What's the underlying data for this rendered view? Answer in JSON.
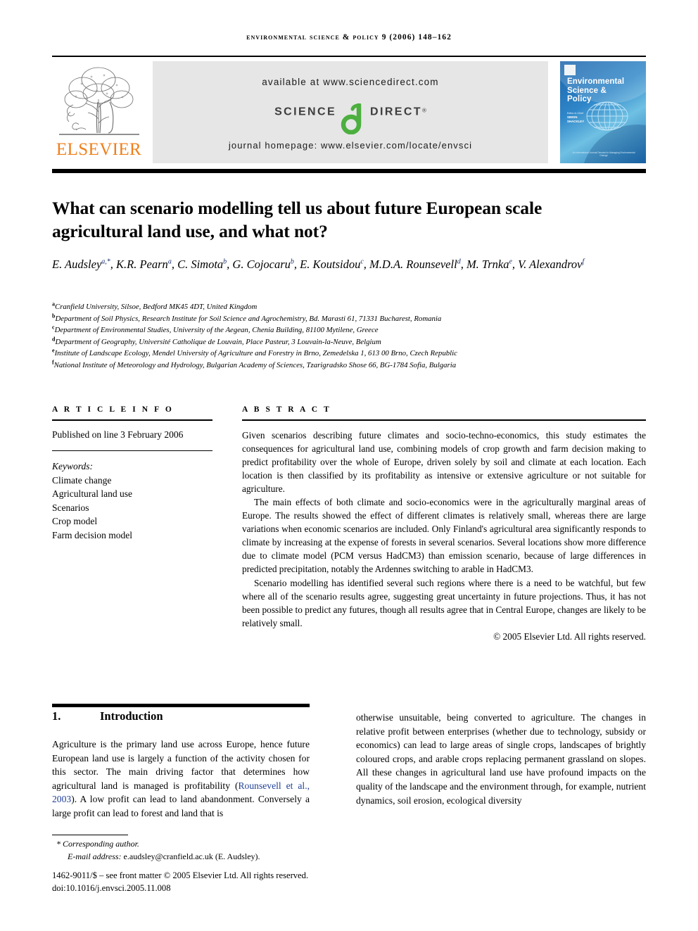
{
  "running_head": "environmental science & policy 9 (2006) 148–162",
  "masthead": {
    "publisher": "ELSEVIER",
    "publisher_logo_icon": "elsevier-tree-icon",
    "available_at": "available at www.sciencedirect.com",
    "sciencedirect_left": "SCIENCE",
    "sciencedirect_right": "DIRECT",
    "sciencedirect_reg": "®",
    "journal_homepage": "journal homepage: www.elsevier.com/locate/envsci",
    "cover": {
      "title": "Environmental Science & Policy",
      "editor_label": "Editor-in-Chief",
      "editor_name": "SIMON SHACKLEY",
      "footer": "An International Journal Devoted to Managing Environmental Change"
    }
  },
  "article": {
    "title": "What can scenario modelling tell us about future European scale agricultural land use, and what not?",
    "authors": [
      {
        "name": "E. Audsley",
        "marks": "a,*"
      },
      {
        "name": "K.R. Pearn",
        "marks": "a"
      },
      {
        "name": "C. Simota",
        "marks": "b"
      },
      {
        "name": "G. Cojocaru",
        "marks": "b"
      },
      {
        "name": "E. Koutsidou",
        "marks": "c"
      },
      {
        "name": "M.D.A. Rounsevell",
        "marks": "d"
      },
      {
        "name": "M. Trnka",
        "marks": "e"
      },
      {
        "name": "V. Alexandrov",
        "marks": "f"
      }
    ],
    "affiliations": [
      {
        "mark": "a",
        "text": "Cranfield University, Silsoe, Bedford MK45 4DT, United Kingdom"
      },
      {
        "mark": "b",
        "text": "Department of Soil Physics, Research Institute for Soil Science and Agrochemistry, Bd. Marasti 61, 71331 Bucharest, Romania"
      },
      {
        "mark": "c",
        "text": "Department of Environmental Studies, University of the Aegean, Chenia Building, 81100 Mytilene, Greece"
      },
      {
        "mark": "d",
        "text": "Department of Geography, Université Catholique de Louvain, Place Pasteur, 3 Louvain-la-Neuve, Belgium"
      },
      {
        "mark": "e",
        "text": "Institute of Landscape Ecology, Mendel University of Agriculture and Forestry in Brno, Zemedelska 1, 613 00 Brno, Czech Republic"
      },
      {
        "mark": "f",
        "text": "National Institute of Meteorology and Hydrology, Bulgarian Academy of Sciences, Tzarigradsko Shose 66, BG-1784 Sofia, Bulgaria"
      }
    ]
  },
  "article_info": {
    "heading": "A R T I C L E   I N F O",
    "published": "Published on line 3 February 2006",
    "keywords_label": "Keywords:",
    "keywords": [
      "Climate change",
      "Agricultural land use",
      "Scenarios",
      "Crop model",
      "Farm decision model"
    ]
  },
  "abstract": {
    "heading": "A B S T R A C T",
    "paragraphs": [
      "Given scenarios describing future climates and socio-techno-economics, this study estimates the consequences for agricultural land use, combining models of crop growth and farm decision making to predict profitability over the whole of Europe, driven solely by soil and climate at each location. Each location is then classified by its profitability as intensive or extensive agriculture or not suitable for agriculture.",
      "The main effects of both climate and socio-economics were in the agriculturally marginal areas of Europe. The results showed the effect of different climates is relatively small, whereas there are large variations when economic scenarios are included. Only Finland's agricultural area significantly responds to climate by increasing at the expense of forests in several scenarios. Several locations show more difference due to climate model (PCM versus HadCM3) than emission scenario, because of large differences in predicted precipitation, notably the Ardennes switching to arable in HadCM3.",
      "Scenario modelling has identified several such regions where there is a need to be watchful, but few where all of the scenario results agree, suggesting great uncertainty in future projections. Thus, it has not been possible to predict any futures, though all results agree that in Central Europe, changes are likely to be relatively small."
    ],
    "copyright": "© 2005 Elsevier Ltd. All rights reserved."
  },
  "introduction": {
    "number": "1.",
    "title": "Introduction",
    "column_left_pre": "Agriculture is the primary land use across Europe, hence future European land use is largely a function of the activity chosen for this sector. The main driving factor that determines how agricultural land is managed is profitability (",
    "column_left_citation": "Rounsevell et al., 2003",
    "column_left_post": "). A low profit can lead to land abandonment. Conversely a large profit can lead to forest and land that is",
    "column_right": "otherwise unsuitable, being converted to agriculture. The changes in relative profit between enterprises (whether due to technology, subsidy or economics) can lead to large areas of single crops, landscapes of brightly coloured crops, and arable crops replacing permanent grassland on slopes. All these changes in agricultural land use have profound impacts on the quality of the landscape and the environment through, for example, nutrient dynamics, soil erosion, ecological diversity"
  },
  "footnotes": {
    "corresponding": "* Corresponding author.",
    "email_label": "E-mail address:",
    "email_value": "e.audsley@cranfield.ac.uk (E. Audsley).",
    "front_matter": "1462-9011/$ – see front matter © 2005 Elsevier Ltd. All rights reserved.",
    "doi": "doi:10.1016/j.envsci.2005.11.008"
  },
  "colors": {
    "banner_gray": "#e6e6e6",
    "elsevier_orange": "#ef7f1a",
    "sciencedirect_green": "#4caf3f",
    "citation_blue": "#1f3f96",
    "cover_blue": "#1963ab"
  }
}
